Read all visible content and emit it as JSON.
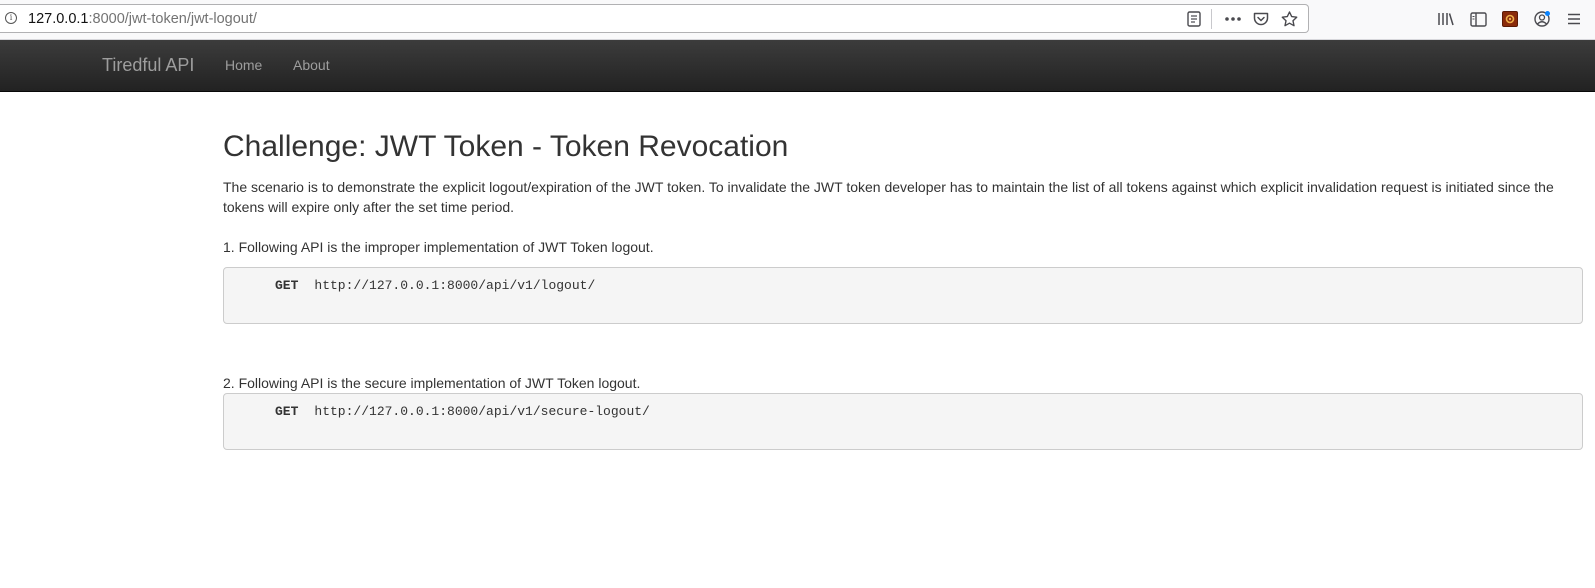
{
  "browser": {
    "url_host": "127.0.0.1",
    "url_rest": ":8000/jwt-token/jwt-logout/",
    "url_actions": [
      "reader-view-icon",
      "more-options-icon",
      "pocket-icon",
      "bookmark-star-icon"
    ],
    "toolbar_icons": [
      "library-icon",
      "sidebar-icon",
      "extension-icon",
      "account-icon",
      "hamburger-menu-icon"
    ]
  },
  "navbar": {
    "brand": "Tiredful API",
    "links": [
      {
        "label": "Home"
      },
      {
        "label": "About"
      }
    ]
  },
  "main": {
    "title": "Challenge: JWT Token - Token Revocation",
    "description": "The scenario is to demonstrate the explicit logout/expiration of the JWT token. To invalidate the JWT token developer has to maintain the list of all tokens against which explicit invalidation request is initiated since the tokens will expire only after the set time period.",
    "steps": [
      {
        "text": "1. Following API is the improper implementation of JWT Token logout.",
        "method": "GET",
        "endpoint": "http://127.0.0.1:8000/api/v1/logout/"
      },
      {
        "text": "2. Following API is the secure implementation of JWT Token logout.",
        "method": "GET",
        "endpoint": "http://127.0.0.1:8000/api/v1/secure-logout/"
      }
    ]
  },
  "colors": {
    "navbar_bg": "#222222",
    "navbar_text": "#9d9d9d",
    "code_bg": "#f5f5f5",
    "code_border": "#cccccc"
  }
}
